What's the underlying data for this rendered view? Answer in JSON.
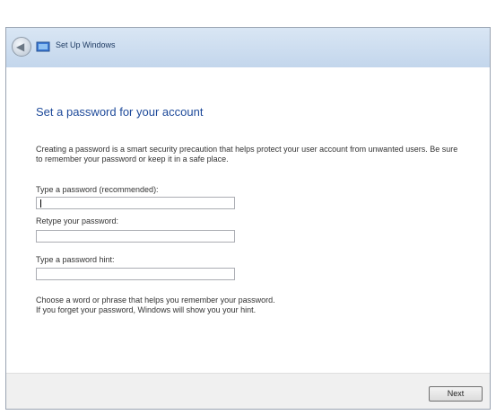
{
  "window": {
    "title": "Set Up Windows",
    "back_icon": "back-arrow-icon",
    "wizard_icon": "setup-wizard-icon"
  },
  "page": {
    "heading": "Set a password for your account",
    "description": "Creating a password is a smart security precaution that helps protect your user account from unwanted users. Be sure to remember your password or keep it in a safe place."
  },
  "fields": {
    "password_label": "Type a password (recommended):",
    "password_value": "",
    "retype_label": "Retype your password:",
    "retype_value": "",
    "hint_label": "Type a password hint:",
    "hint_value": ""
  },
  "hint_note": {
    "line1": "Choose a word or phrase that helps you remember your password.",
    "line2": "If you forget your password, Windows will show you your hint."
  },
  "footer": {
    "next_label": "Next"
  },
  "colors": {
    "heading": "#1e4a9a",
    "titlebar": "#c3d6ec",
    "footer": "#f0f0f0"
  }
}
